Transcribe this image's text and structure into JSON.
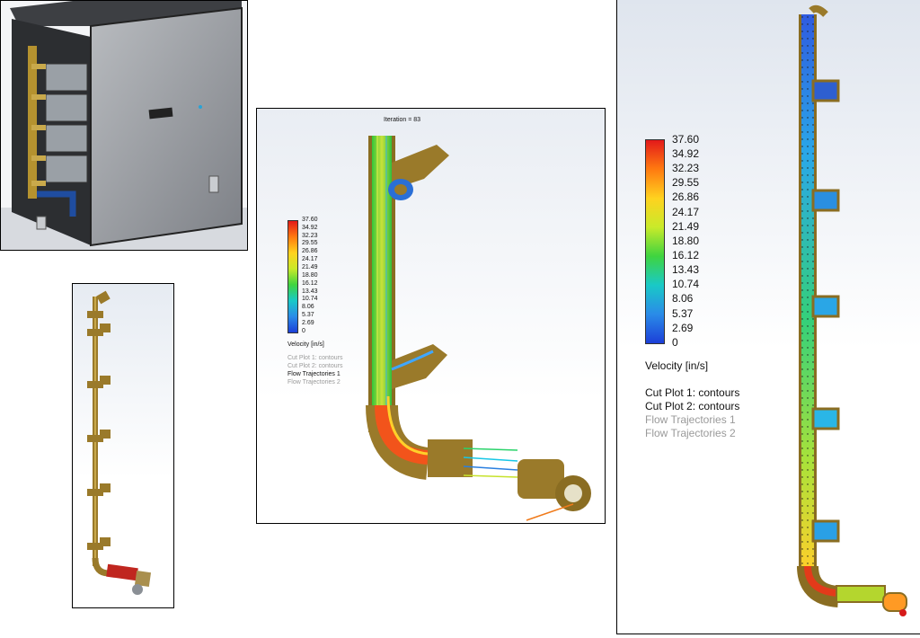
{
  "scale": {
    "ticks": [
      "37.60",
      "34.92",
      "32.23",
      "29.55",
      "26.86",
      "24.17",
      "21.49",
      "18.80",
      "16.12",
      "13.43",
      "10.74",
      "8.06",
      "5.37",
      "2.69",
      "0"
    ],
    "title": "Velocity [in/s]",
    "entries": [
      {
        "label": "Cut Plot 1: contours",
        "active": true
      },
      {
        "label": "Cut Plot 2: contours",
        "active": true
      },
      {
        "label": "Flow Trajectories 1",
        "active": false
      },
      {
        "label": "Flow Trajectories 2",
        "active": false
      }
    ],
    "mid_entries_active": [
      false,
      false,
      true,
      false
    ]
  },
  "mid_panel": {
    "iteration": "Iteration = 83"
  },
  "colors": {
    "brass": "#9a7a2a",
    "brass_light": "#c9a94b",
    "cabinet": "#8c8f93",
    "entry_active": "#111111",
    "entry_inactive": "#9a9a9a"
  }
}
